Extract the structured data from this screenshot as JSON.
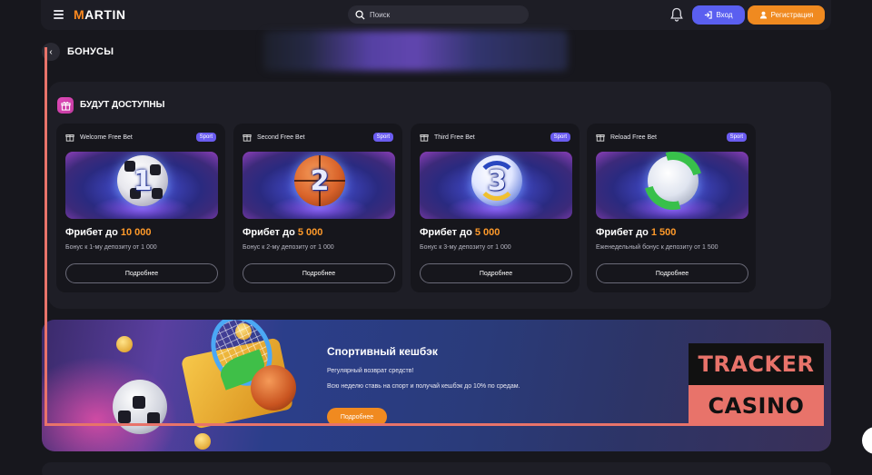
{
  "header": {
    "logo": "MARTIN",
    "search_placeholder": "Поиск",
    "login_label": "Вход",
    "register_label": "Регистрация"
  },
  "page": {
    "title": "БОНУСЫ"
  },
  "section": {
    "title": "БУДУТ ДОСТУПНЫ"
  },
  "cards": [
    {
      "name": "Welcome Free Bet",
      "badge": "Sport",
      "number": "1",
      "offer_prefix": "Фрибет до",
      "offer_amount": "10 000",
      "desc": "Бонус к 1-му депозиту от 1 000",
      "button": "Подробнее",
      "ball": "soccer-ball"
    },
    {
      "name": "Second Free Bet",
      "badge": "Sport",
      "number": "2",
      "offer_prefix": "Фрибет до",
      "offer_amount": "5 000",
      "desc": "Бонус к 2-му депозиту от 1 000",
      "button": "Подробнее",
      "ball": "basketball"
    },
    {
      "name": "Third Free Bet",
      "badge": "Sport",
      "number": "3",
      "offer_prefix": "Фрибет до",
      "offer_amount": "5 000",
      "desc": "Бонус к 3-му депозиту от 1 000",
      "button": "Подробнее",
      "ball": "volleyball"
    },
    {
      "name": "Reload Free Bet",
      "badge": "Sport",
      "number": "",
      "offer_prefix": "Фрибет до",
      "offer_amount": "1 500",
      "desc": "Еженедельный бонус к депозиту от 1 500",
      "button": "Подробнее",
      "ball": "reload-soccer-ball"
    }
  ],
  "cashback": {
    "title": "Спортивный кешбэк",
    "subtitle": "Регулярный возврат средств!",
    "desc": "Всю неделю ставь на спорт и получай кешбэк до 10% по средам.",
    "button": "Подробнее"
  },
  "watermark": {
    "line1": "TRACKER",
    "line2": "CASINO"
  },
  "colors": {
    "accent_orange": "#f08a20",
    "accent_purple": "#5a5ff0",
    "badge_purple": "#6a5cf0",
    "watermark_salmon": "#e8736a"
  }
}
